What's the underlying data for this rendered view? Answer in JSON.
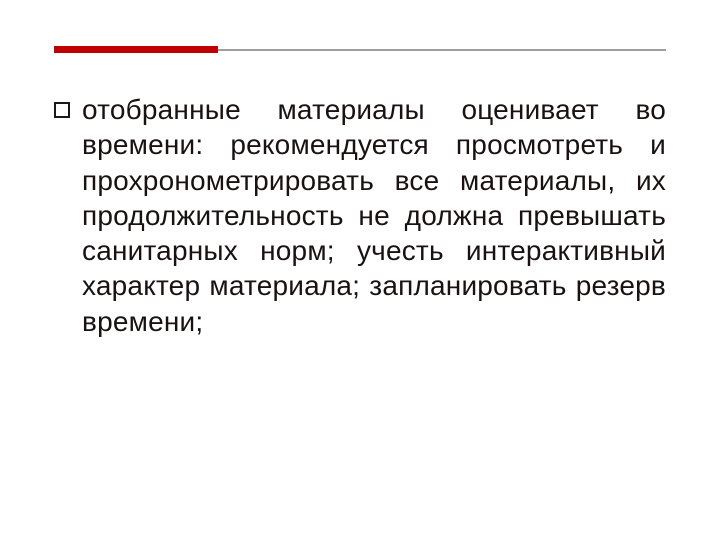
{
  "colors": {
    "rule_accent": "#c00000",
    "rule_muted": "#9e9e9e",
    "text": "#1a1212"
  },
  "slide": {
    "items": [
      {
        "text": "отобранные материалы оценивает во времени: рекомендуется просмотреть и прохронометрировать все материалы, их продолжительность не должна превышать санитарных норм; учесть интерактивный характер материала; запланировать резерв времени;"
      }
    ]
  }
}
